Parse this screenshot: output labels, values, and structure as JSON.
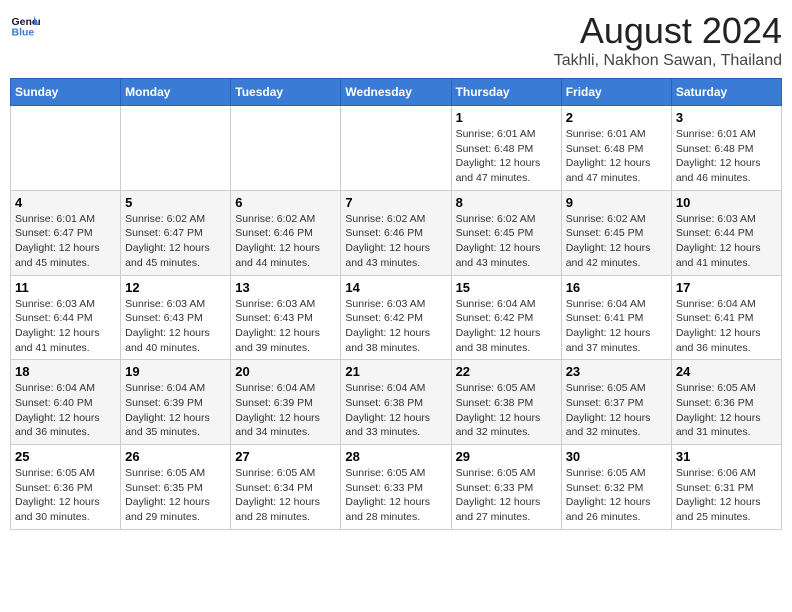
{
  "header": {
    "logo_text_general": "General",
    "logo_text_blue": "Blue",
    "month_title": "August 2024",
    "location": "Takhli, Nakhon Sawan, Thailand"
  },
  "days_of_week": [
    "Sunday",
    "Monday",
    "Tuesday",
    "Wednesday",
    "Thursday",
    "Friday",
    "Saturday"
  ],
  "weeks": [
    [
      {
        "day": "",
        "info": ""
      },
      {
        "day": "",
        "info": ""
      },
      {
        "day": "",
        "info": ""
      },
      {
        "day": "",
        "info": ""
      },
      {
        "day": "1",
        "info": "Sunrise: 6:01 AM\nSunset: 6:48 PM\nDaylight: 12 hours\nand 47 minutes."
      },
      {
        "day": "2",
        "info": "Sunrise: 6:01 AM\nSunset: 6:48 PM\nDaylight: 12 hours\nand 47 minutes."
      },
      {
        "day": "3",
        "info": "Sunrise: 6:01 AM\nSunset: 6:48 PM\nDaylight: 12 hours\nand 46 minutes."
      }
    ],
    [
      {
        "day": "4",
        "info": "Sunrise: 6:01 AM\nSunset: 6:47 PM\nDaylight: 12 hours\nand 45 minutes."
      },
      {
        "day": "5",
        "info": "Sunrise: 6:02 AM\nSunset: 6:47 PM\nDaylight: 12 hours\nand 45 minutes."
      },
      {
        "day": "6",
        "info": "Sunrise: 6:02 AM\nSunset: 6:46 PM\nDaylight: 12 hours\nand 44 minutes."
      },
      {
        "day": "7",
        "info": "Sunrise: 6:02 AM\nSunset: 6:46 PM\nDaylight: 12 hours\nand 43 minutes."
      },
      {
        "day": "8",
        "info": "Sunrise: 6:02 AM\nSunset: 6:45 PM\nDaylight: 12 hours\nand 43 minutes."
      },
      {
        "day": "9",
        "info": "Sunrise: 6:02 AM\nSunset: 6:45 PM\nDaylight: 12 hours\nand 42 minutes."
      },
      {
        "day": "10",
        "info": "Sunrise: 6:03 AM\nSunset: 6:44 PM\nDaylight: 12 hours\nand 41 minutes."
      }
    ],
    [
      {
        "day": "11",
        "info": "Sunrise: 6:03 AM\nSunset: 6:44 PM\nDaylight: 12 hours\nand 41 minutes."
      },
      {
        "day": "12",
        "info": "Sunrise: 6:03 AM\nSunset: 6:43 PM\nDaylight: 12 hours\nand 40 minutes."
      },
      {
        "day": "13",
        "info": "Sunrise: 6:03 AM\nSunset: 6:43 PM\nDaylight: 12 hours\nand 39 minutes."
      },
      {
        "day": "14",
        "info": "Sunrise: 6:03 AM\nSunset: 6:42 PM\nDaylight: 12 hours\nand 38 minutes."
      },
      {
        "day": "15",
        "info": "Sunrise: 6:04 AM\nSunset: 6:42 PM\nDaylight: 12 hours\nand 38 minutes."
      },
      {
        "day": "16",
        "info": "Sunrise: 6:04 AM\nSunset: 6:41 PM\nDaylight: 12 hours\nand 37 minutes."
      },
      {
        "day": "17",
        "info": "Sunrise: 6:04 AM\nSunset: 6:41 PM\nDaylight: 12 hours\nand 36 minutes."
      }
    ],
    [
      {
        "day": "18",
        "info": "Sunrise: 6:04 AM\nSunset: 6:40 PM\nDaylight: 12 hours\nand 36 minutes."
      },
      {
        "day": "19",
        "info": "Sunrise: 6:04 AM\nSunset: 6:39 PM\nDaylight: 12 hours\nand 35 minutes."
      },
      {
        "day": "20",
        "info": "Sunrise: 6:04 AM\nSunset: 6:39 PM\nDaylight: 12 hours\nand 34 minutes."
      },
      {
        "day": "21",
        "info": "Sunrise: 6:04 AM\nSunset: 6:38 PM\nDaylight: 12 hours\nand 33 minutes."
      },
      {
        "day": "22",
        "info": "Sunrise: 6:05 AM\nSunset: 6:38 PM\nDaylight: 12 hours\nand 32 minutes."
      },
      {
        "day": "23",
        "info": "Sunrise: 6:05 AM\nSunset: 6:37 PM\nDaylight: 12 hours\nand 32 minutes."
      },
      {
        "day": "24",
        "info": "Sunrise: 6:05 AM\nSunset: 6:36 PM\nDaylight: 12 hours\nand 31 minutes."
      }
    ],
    [
      {
        "day": "25",
        "info": "Sunrise: 6:05 AM\nSunset: 6:36 PM\nDaylight: 12 hours\nand 30 minutes."
      },
      {
        "day": "26",
        "info": "Sunrise: 6:05 AM\nSunset: 6:35 PM\nDaylight: 12 hours\nand 29 minutes."
      },
      {
        "day": "27",
        "info": "Sunrise: 6:05 AM\nSunset: 6:34 PM\nDaylight: 12 hours\nand 28 minutes."
      },
      {
        "day": "28",
        "info": "Sunrise: 6:05 AM\nSunset: 6:33 PM\nDaylight: 12 hours\nand 28 minutes."
      },
      {
        "day": "29",
        "info": "Sunrise: 6:05 AM\nSunset: 6:33 PM\nDaylight: 12 hours\nand 27 minutes."
      },
      {
        "day": "30",
        "info": "Sunrise: 6:05 AM\nSunset: 6:32 PM\nDaylight: 12 hours\nand 26 minutes."
      },
      {
        "day": "31",
        "info": "Sunrise: 6:06 AM\nSunset: 6:31 PM\nDaylight: 12 hours\nand 25 minutes."
      }
    ]
  ]
}
